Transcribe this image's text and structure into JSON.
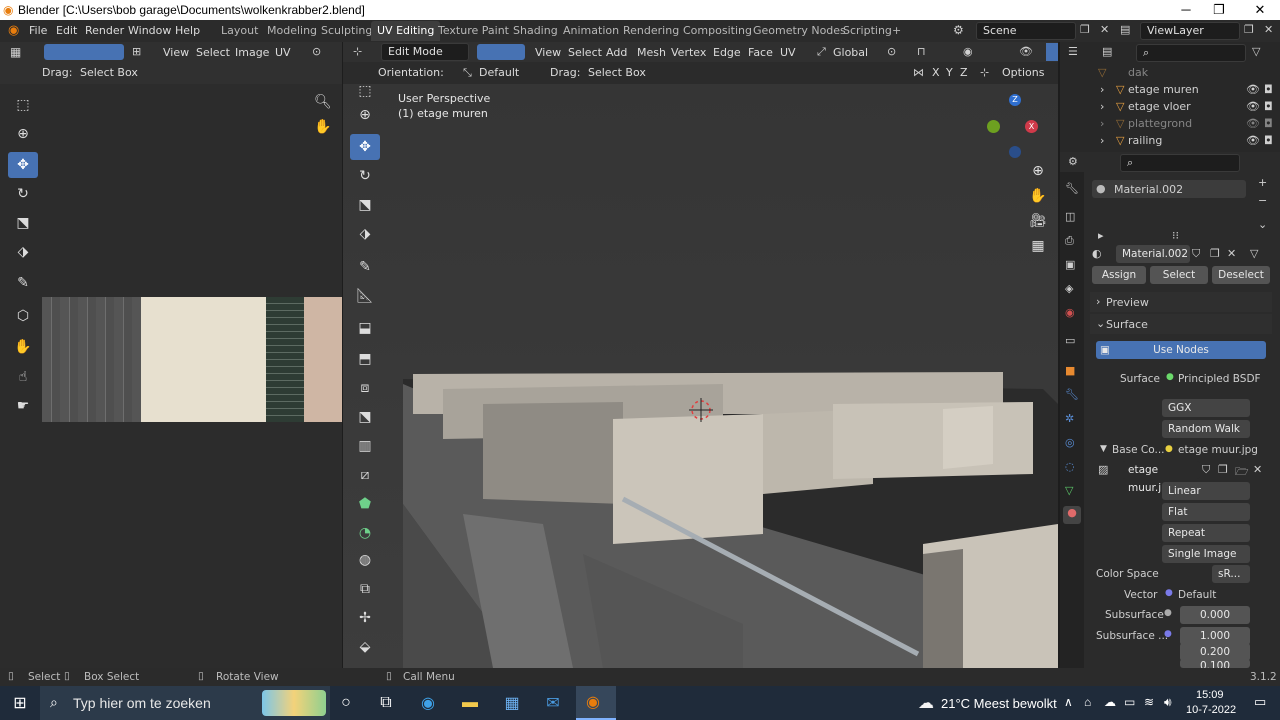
{
  "window": {
    "title": "Blender [C:\\Users\\bob garage\\Documents\\wolkenkrabber2.blend]"
  },
  "menu": [
    "File",
    "Edit",
    "Render",
    "Window",
    "Help"
  ],
  "workspaces": [
    "Layout",
    "Modeling",
    "Sculpting",
    "UV Editing",
    "Texture Paint",
    "Shading",
    "Animation",
    "Rendering",
    "Compositing",
    "Geometry Nodes",
    "Scripting",
    "+"
  ],
  "active_workspace": "UV Editing",
  "scene": "Scene",
  "view_layer": "ViewLayer",
  "uv_editor": {
    "menus": [
      "View",
      "Select",
      "Image",
      "UV"
    ],
    "drag_label": "Drag:",
    "drag_value": "Select Box"
  },
  "viewport": {
    "mode": "Edit Mode",
    "menus": [
      "View",
      "Select",
      "Add",
      "Mesh",
      "Vertex",
      "Edge",
      "Face",
      "UV"
    ],
    "transform": "Global",
    "orientation_label": "Orientation:",
    "orientation_value": "Default",
    "drag_label": "Drag:",
    "drag_value": "Select Box",
    "axes": [
      "X",
      "Y",
      "Z"
    ],
    "options_label": "Options",
    "overlay_line1": "User Perspective",
    "overlay_line2": "(1) etage muren"
  },
  "outliner": [
    {
      "name": "dak"
    },
    {
      "name": "etage muren"
    },
    {
      "name": "etage vloer"
    },
    {
      "name": "plattegrond"
    },
    {
      "name": "railing"
    }
  ],
  "properties": {
    "material_slot": "Material.002",
    "material_name": "Material.002",
    "assign": "Assign",
    "select": "Select",
    "deselect": "Deselect",
    "preview": "Preview",
    "surface_panel": "Surface",
    "use_nodes": "Use Nodes",
    "surface_label": "Surface",
    "surface_value": "Principled BSDF",
    "distribution": "GGX",
    "subsurface_method": "Random Walk",
    "base_color_label": "Base Co...",
    "base_color_value": "etage muur.jpg",
    "image_name": "etage muur.jpg",
    "interpolation": "Linear",
    "projection": "Flat",
    "extension": "Repeat",
    "source": "Single Image",
    "color_space_label": "Color Space",
    "color_space_value": "sR...",
    "vector_label": "Vector",
    "vector_value": "Default",
    "subsurface_label": "Subsurface",
    "subsurface_value": "0.000",
    "subsurface_radius_label": "Subsurface ...",
    "radius_values": [
      "1.000",
      "0.200",
      "0.100"
    ]
  },
  "statusbar": {
    "select": "Select",
    "box_select": "Box Select",
    "rotate_view": "Rotate View",
    "call_menu": "Call Menu",
    "version": "3.1.2"
  },
  "taskbar": {
    "search_placeholder": "Typ hier om te zoeken",
    "weather": "21°C  Meest bewolkt",
    "time": "15:09",
    "date": "10-7-2022"
  },
  "colors": {
    "accent": "#4772b3",
    "taskbar": "#1f2b3a"
  }
}
